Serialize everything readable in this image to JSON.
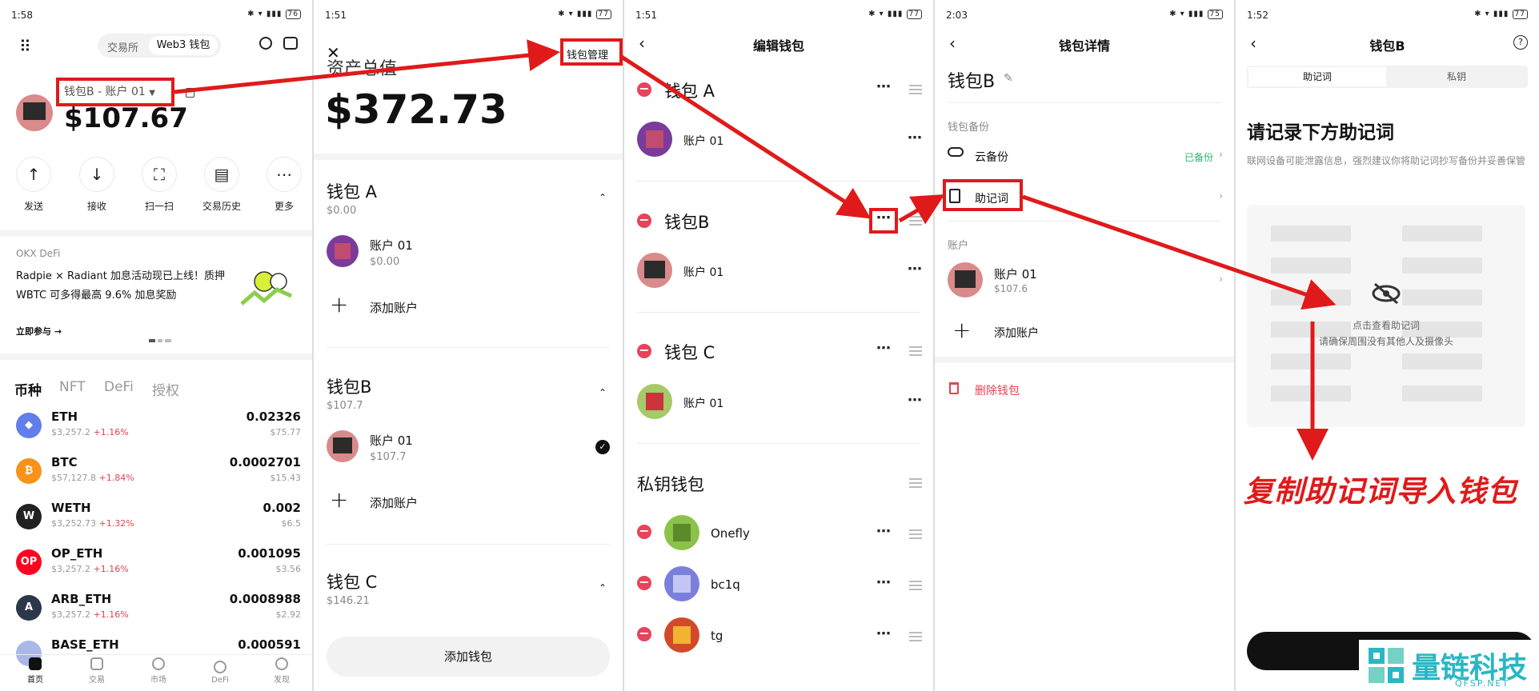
{
  "colors": {
    "annotation_red": "#e01a1a",
    "accent_green": "#2bb673",
    "delete_red": "#e5424f"
  },
  "p1": {
    "time": "1:58",
    "tabs": [
      "交易所",
      "Web3 钱包"
    ],
    "wallet_account": "钱包B - 账户 01",
    "balance": "$107.67",
    "actions": [
      "发送",
      "接收",
      "扫一扫",
      "交易历史",
      "更多"
    ],
    "banner": {
      "source": "OKX DeFi",
      "line1": "Radpie × Radiant 加息活动现已上线！质押",
      "line2": "WBTC 可多得最高 9.6% 加息奖励",
      "cta": "立即参与 →"
    },
    "asset_tabs": [
      "币种",
      "NFT",
      "DeFi",
      "授权"
    ],
    "coins": [
      {
        "name": "ETH",
        "price": "$3,257.2",
        "change": "+1.16%",
        "amount": "0.02326",
        "usd": "$75.77",
        "color": "#627eea",
        "icon": "eth-icon",
        "glyph": "◆"
      },
      {
        "name": "BTC",
        "price": "$57,127.8",
        "change": "+1.84%",
        "amount": "0.0002701",
        "usd": "$15.43",
        "color": "#f7931a",
        "icon": "btc-icon",
        "glyph": "₿"
      },
      {
        "name": "WETH",
        "price": "$3,252.73",
        "change": "+1.32%",
        "amount": "0.002",
        "usd": "$6.5",
        "color": "#222222",
        "icon": "weth-icon",
        "glyph": "W"
      },
      {
        "name": "OP_ETH",
        "price": "$3,257.2",
        "change": "+1.16%",
        "amount": "0.001095",
        "usd": "$3.56",
        "color": "#ff0420",
        "icon": "op-icon",
        "glyph": "OP"
      },
      {
        "name": "ARB_ETH",
        "price": "$3,257.2",
        "change": "+1.16%",
        "amount": "0.0008988",
        "usd": "$2.92",
        "color": "#2d374b",
        "icon": "arb-icon",
        "glyph": "A"
      },
      {
        "name": "BASE_ETH",
        "price": "",
        "change": "",
        "amount": "0.000591",
        "usd": "",
        "color": "#aab8e8",
        "icon": "base-icon",
        "glyph": ""
      }
    ],
    "nav": [
      "首页",
      "交易",
      "市场",
      "DeFi",
      "发现"
    ]
  },
  "p2": {
    "time": "1:51",
    "manage": "钱包管理",
    "total_label": "资产总值",
    "total": "$372.73",
    "wallets": [
      {
        "name": "钱包 A",
        "value": "$0.00",
        "account": "账户 01",
        "acc_value": "$0.00"
      },
      {
        "name": "钱包B",
        "value": "$107.7",
        "account": "账户 01",
        "acc_value": "$107.7"
      },
      {
        "name": "钱包 C",
        "value": "$146.21"
      }
    ],
    "add_account": "添加账户",
    "add_wallet": "添加钱包"
  },
  "p3": {
    "time": "1:51",
    "title": "编辑钱包",
    "wallets": [
      "钱包 A",
      "钱包B",
      "钱包 C"
    ],
    "account": "账户 01",
    "private_title": "私钥钱包",
    "private": [
      "Onefly",
      "bc1q",
      "tg"
    ]
  },
  "p4": {
    "time": "2:03",
    "title": "钱包详情",
    "wallet_name": "钱包B",
    "backup_section": "钱包备份",
    "cloud": "云备份",
    "cloud_status": "已备份",
    "mnemonic": "助记词",
    "account_section": "账户",
    "account": "账户 01",
    "account_value": "$107.6",
    "add_account": "添加账户",
    "delete": "删除钱包"
  },
  "p5": {
    "time": "1:52",
    "title": "钱包B",
    "tabs": [
      "助记词",
      "私钥"
    ],
    "heading": "请记录下方助记词",
    "desc": "联网设备可能泄露信息，强烈建议你将助记词抄写备份并妥善保管",
    "reveal1": "点击查看助记词",
    "reveal2": "请确保周围没有其他人及摄像头",
    "annotation": "复制助记词导入钱包",
    "watermark_cn": "量链科技",
    "watermark_en": "QFSP.NET"
  }
}
